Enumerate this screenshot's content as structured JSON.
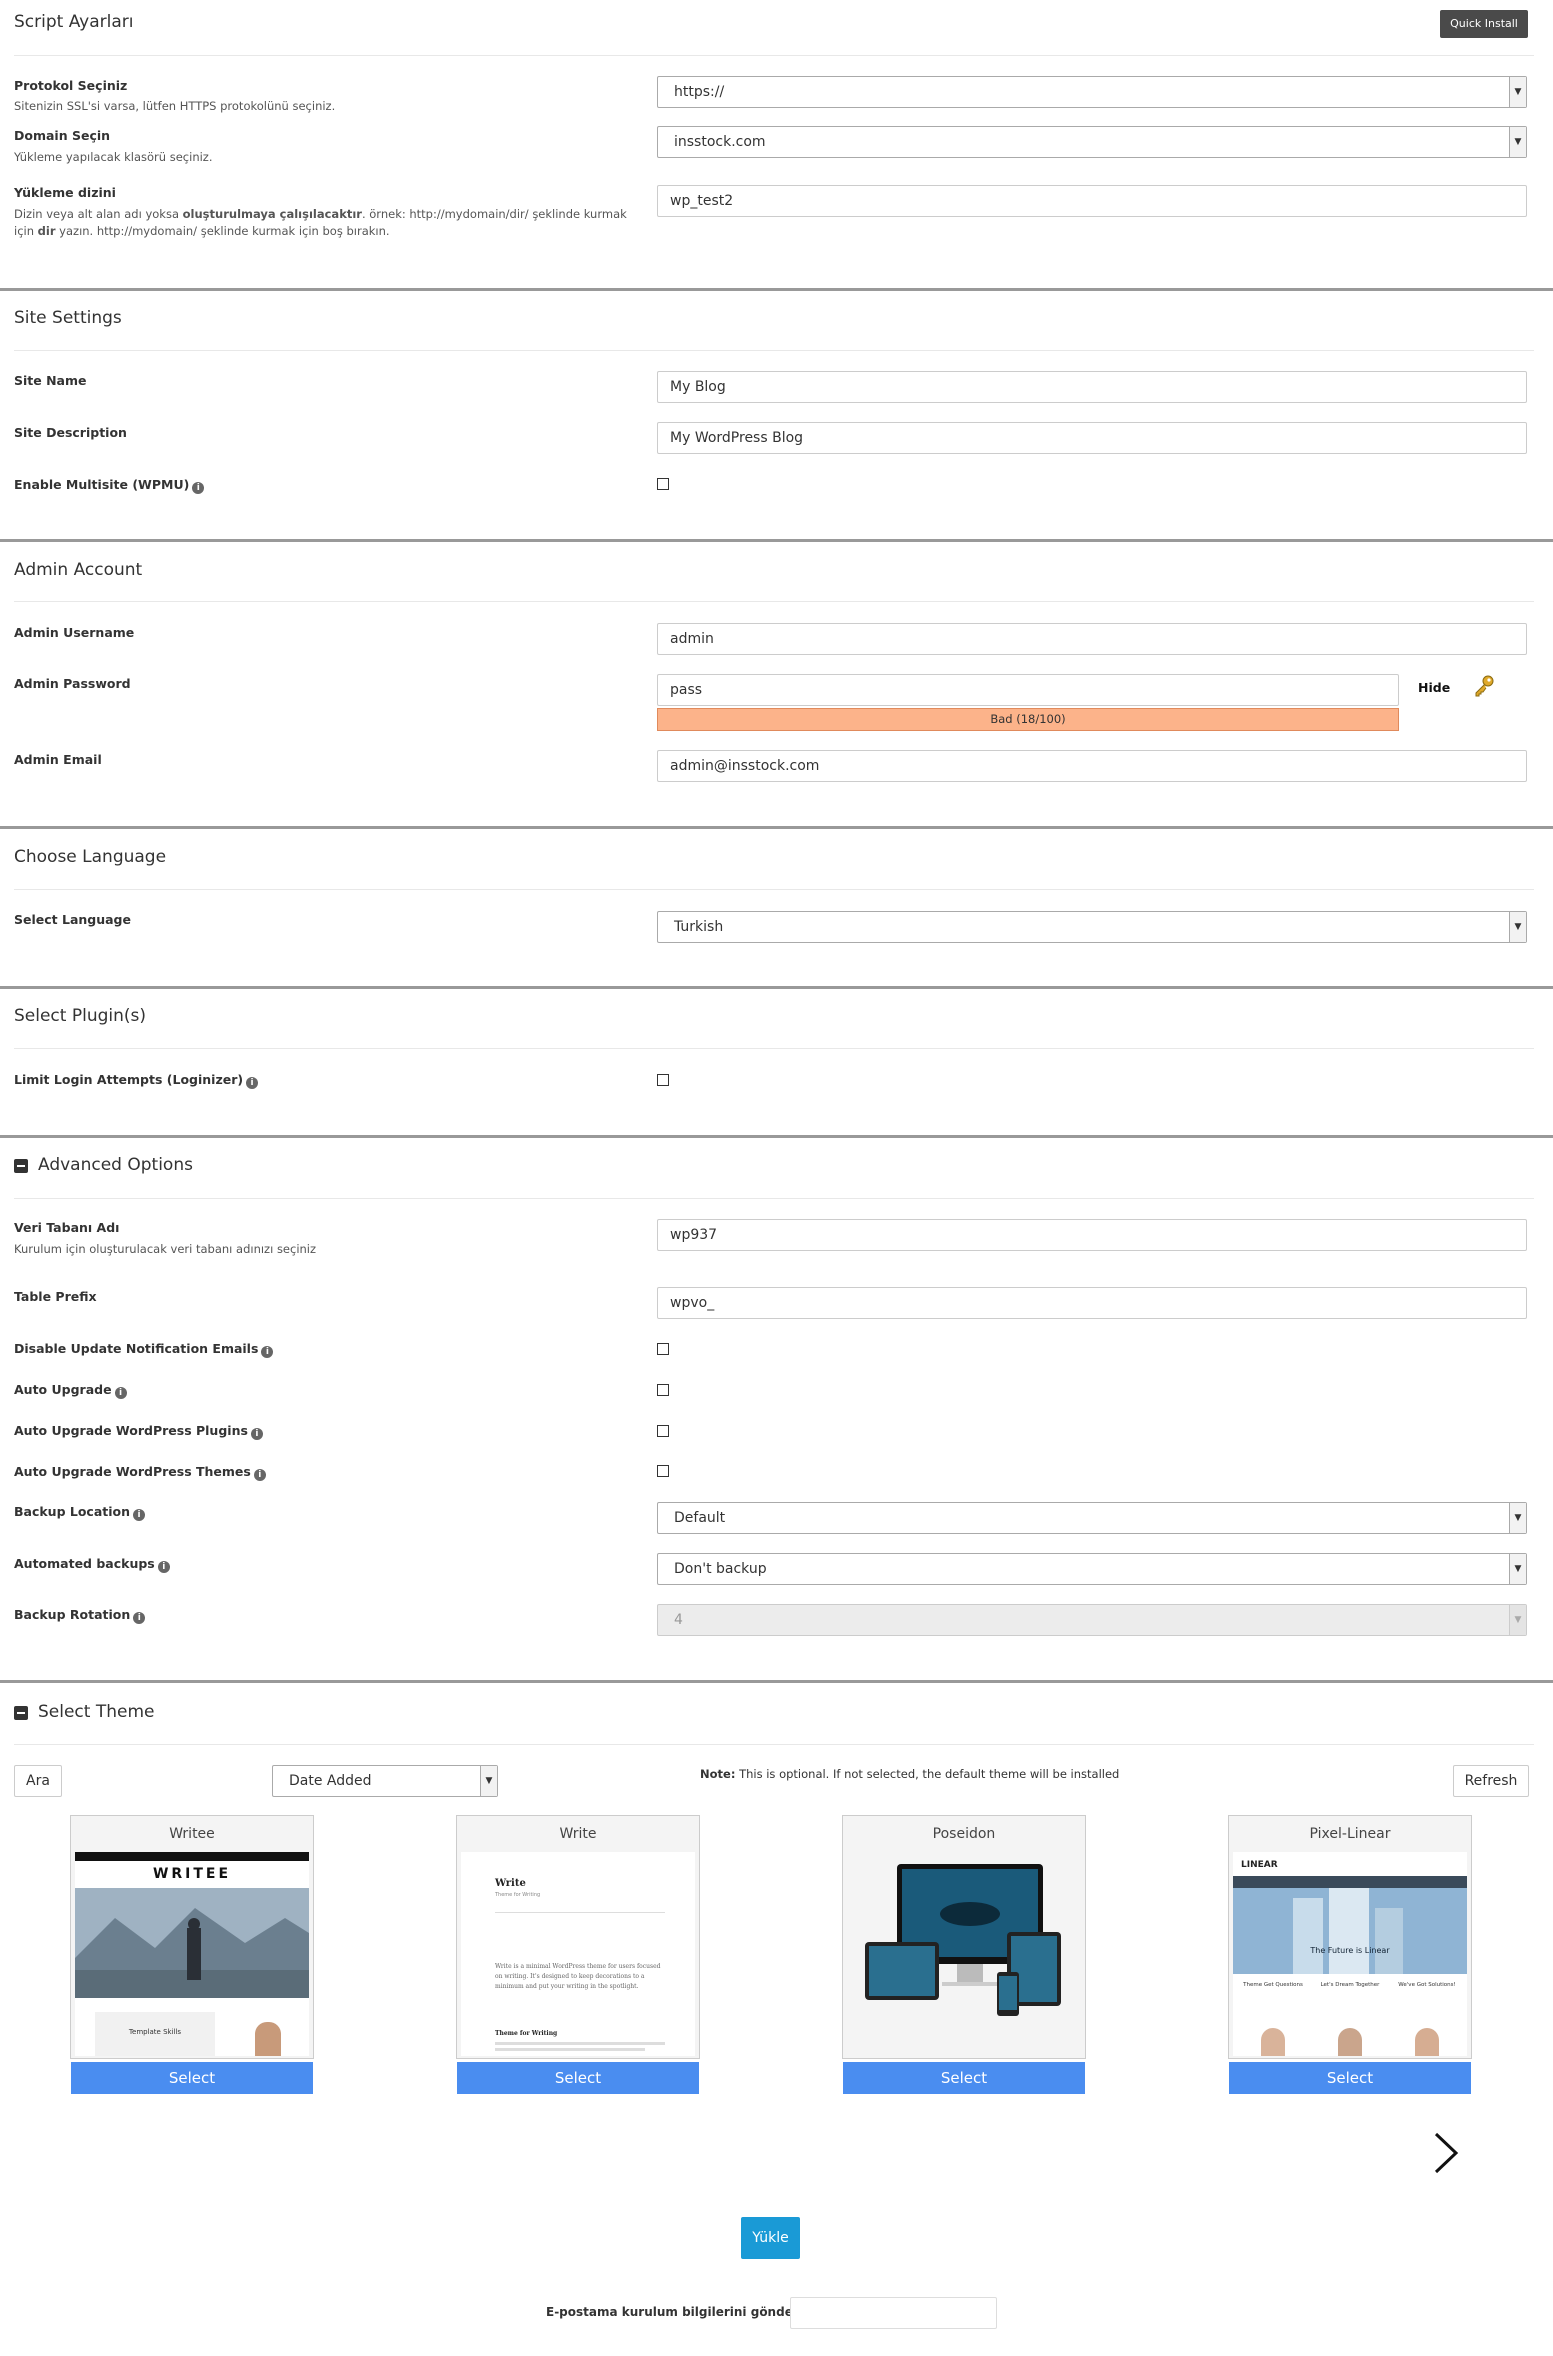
{
  "script_settings": {
    "title": "Script Ayarları",
    "quick_install": "Quick Install",
    "protocol": {
      "label": "Protokol Seçiniz",
      "desc": "Sitenizin SSL'si varsa, lütfen HTTPS protokolünü seçiniz.",
      "value": "https://"
    },
    "domain": {
      "label": "Domain Seçin",
      "desc": "Yükleme yapılacak klasörü seçiniz.",
      "value": "insstock.com"
    },
    "directory": {
      "label": "Yükleme dizini",
      "desc_1": "Dizin veya alt alan adı yoksa ",
      "desc_bold_1": "oluşturulmaya çalışılacaktır",
      "desc_2": ". örnek: http://mydomain/dir/ şeklinde kurmak için ",
      "desc_bold_2": "dir",
      "desc_3": " yazın. http://mydomain/ şeklinde kurmak için boş bırakın.",
      "value": "wp_test2"
    }
  },
  "site_settings": {
    "title": "Site Settings",
    "site_name": {
      "label": "Site Name",
      "value": "My Blog"
    },
    "site_description": {
      "label": "Site Description",
      "value": "My WordPress Blog"
    },
    "multisite": {
      "label": "Enable Multisite (WPMU)"
    }
  },
  "admin_account": {
    "title": "Admin Account",
    "username": {
      "label": "Admin Username",
      "value": "admin"
    },
    "password": {
      "label": "Admin Password",
      "value": "pass",
      "hide": "Hide",
      "strength": "Bad (18/100)"
    },
    "email": {
      "label": "Admin Email",
      "value": "admin@insstock.com"
    }
  },
  "language": {
    "title": "Choose Language",
    "label": "Select Language",
    "value": "Turkish"
  },
  "plugins": {
    "title": "Select Plugin(s)",
    "limit_login": "Limit Login Attempts (Loginizer)"
  },
  "advanced": {
    "title": "Advanced Options",
    "db_name": {
      "label": "Veri Tabanı Adı",
      "desc": "Kurulum için oluşturulacak veri tabanı adınızı seçiniz",
      "value": "wp937"
    },
    "table_prefix": {
      "label": "Table Prefix",
      "value": "wpvo_"
    },
    "disable_update_emails": "Disable Update Notification Emails",
    "auto_upgrade": "Auto Upgrade",
    "auto_upgrade_plugins": "Auto Upgrade WordPress Plugins",
    "auto_upgrade_themes": "Auto Upgrade WordPress Themes",
    "backup_location": {
      "label": "Backup Location",
      "value": "Default"
    },
    "automated_backups": {
      "label": "Automated backups",
      "value": "Don't backup"
    },
    "backup_rotation": {
      "label": "Backup Rotation",
      "value": "4"
    }
  },
  "theme": {
    "title": "Select Theme",
    "search": "Ara",
    "sort": "Date Added",
    "note_label": "Note:",
    "note_text": " This is optional. If not selected, the default theme will be installed",
    "refresh": "Refresh",
    "select_label": "Select",
    "cards": [
      {
        "name": "Writee",
        "logo": "WRITEE",
        "caption": "Template Skills"
      },
      {
        "name": "Write",
        "logo": "Write",
        "tagline": "Theme for Writing",
        "body": "Write is a minimal WordPress theme for users focused on writing. It's designed to keep decorations to a minimum and put your writing in the spotlight.",
        "post_title": "Theme for Writing"
      },
      {
        "name": "Poseidon"
      },
      {
        "name": "Pixel-Linear",
        "logo": "LINEAR",
        "hero": "The Future is Linear",
        "col1": "Theme Get Questions",
        "col2": "Let's Dream Together",
        "col3": "We've Got Solutions!"
      }
    ]
  },
  "footer": {
    "install": "Yükle",
    "email_label": "E-postama kurulum bilgilerini gönder :"
  },
  "colors": {
    "select_blue": "#4a8df0",
    "install_blue": "#1a9ad6",
    "strength_bad": "#fcb38a"
  }
}
